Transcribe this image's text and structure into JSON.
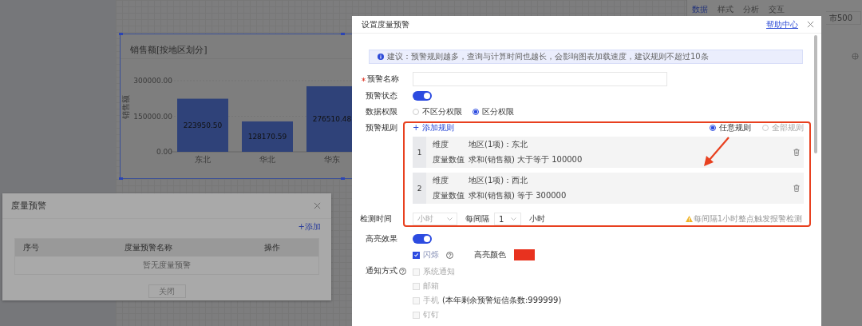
{
  "side_panel": {
    "tabs": [
      {
        "label": "数据",
        "selected": true
      },
      {
        "label": "样式",
        "selected": false
      },
      {
        "label": "分析",
        "selected": false
      },
      {
        "label": "交互",
        "selected": false
      }
    ],
    "field_value": "市500"
  },
  "chart_card": {
    "title": "销售额[按地区划分]",
    "chart_data": {
      "type": "bar",
      "ylabel": "销售额",
      "categories": [
        "东北",
        "华北",
        "华东"
      ],
      "values": [
        223950.5,
        128170.59,
        276510.48
      ],
      "ylim": [
        0,
        300000
      ],
      "yticks": [
        {
          "value": 0,
          "label": "0.00"
        },
        {
          "value": 150000,
          "label": "150000.00"
        },
        {
          "value": 300000,
          "label": "300000.00"
        }
      ],
      "value_labels": [
        "223950.50",
        "128170.59",
        "276510.48"
      ]
    }
  },
  "alert_list_dialog": {
    "title": "度量预警",
    "add_link": "+添加",
    "columns": [
      "序号",
      "度量预警名称",
      "操作"
    ],
    "empty_text": "暂无度量预警",
    "close_button": "关闭"
  },
  "settings_dialog": {
    "title": "设置度量预警",
    "help_link": "帮助中心",
    "notice": "建议：预警规则越多，查询与计算时间也越长，会影响图表加载速度，建议规则不超过10条",
    "name_field": {
      "label": "预警名称",
      "required": true
    },
    "status": {
      "label": "预警状态",
      "on": true
    },
    "permission": {
      "label": "数据权限",
      "options": [
        {
          "label": "不区分权限",
          "selected": false
        },
        {
          "label": "区分权限",
          "selected": true
        }
      ]
    },
    "rules": {
      "label": "预警规则",
      "add_link": "+ 添加规则",
      "match_options": [
        {
          "label": "任意规则",
          "selected": true
        },
        {
          "label": "全部规则",
          "selected": false
        }
      ],
      "items": [
        {
          "index": "1",
          "dimension_label": "维度",
          "dimension_value": "地区(1项)：东北",
          "measure_label": "度量数值",
          "measure_value": "求和(销售额) 大于等于 100000"
        },
        {
          "index": "2",
          "dimension_label": "维度",
          "dimension_value": "地区(1项)：西北",
          "measure_label": "度量数值",
          "measure_value": "求和(销售额) 等于 300000"
        }
      ]
    },
    "check_time": {
      "label": "检测时间",
      "unit_placeholder": "小时",
      "interval_label": "每间隔",
      "interval_value": "1",
      "interval_unit": "小时",
      "hint": "每间隔1小时整点触发报警检测"
    },
    "highlight": {
      "label": "高亮效果",
      "on": true,
      "blink": {
        "label": "闪烁",
        "checked": true
      },
      "color_label": "高亮颜色",
      "color": "#e8321f"
    },
    "notify": {
      "label": "通知方式",
      "options": [
        {
          "label": "系统通知",
          "checked": false
        },
        {
          "label": "邮箱",
          "checked": false
        },
        {
          "label": "手机",
          "checked": false,
          "note": "(本年剩余预警短信条数:999999)"
        },
        {
          "label": "钉钉",
          "checked": false
        }
      ]
    }
  }
}
